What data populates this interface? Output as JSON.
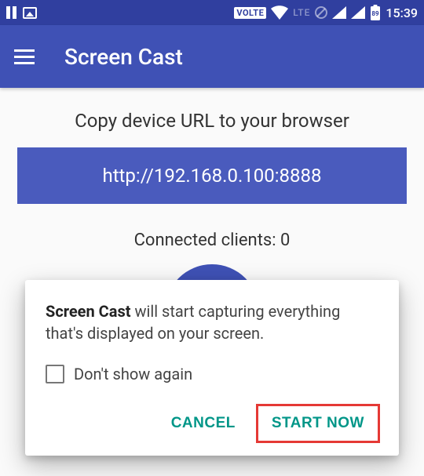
{
  "statusbar": {
    "volte": "VOLTE",
    "lte": "LTE",
    "battery": "89",
    "time": "15:39"
  },
  "appbar": {
    "title": "Screen Cast"
  },
  "main": {
    "instruction": "Copy device URL to your browser",
    "url": "http://192.168.0.100:8888",
    "clients_label": "Connected clients: 0"
  },
  "dialog": {
    "app_name": "Screen Cast",
    "message_rest": " will start capturing everything that's displayed on your screen.",
    "checkbox_label": "Don't show again",
    "cancel": "CANCEL",
    "start": "START NOW"
  }
}
